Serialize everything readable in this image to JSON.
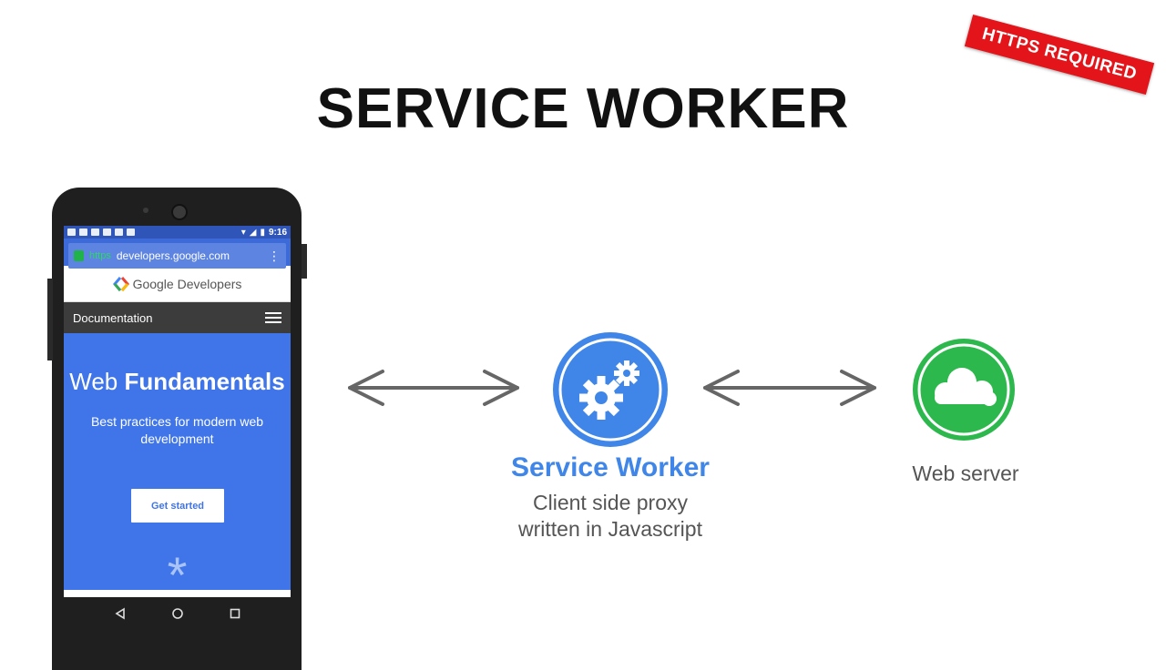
{
  "slide": {
    "title": "SERVICE WORKER",
    "stamp": "HTTPS REQUIRED"
  },
  "phone": {
    "status_time": "9:16",
    "url_scheme": "https",
    "url": "developers.google.com",
    "brand": "Google Developers",
    "nav_label": "Documentation",
    "hero_title_light": "Web ",
    "hero_title_bold": "Fundamentals",
    "hero_subtitle": "Best practices for modern web development",
    "cta_label": "Get started"
  },
  "diagram": {
    "service_worker": {
      "label": "Service Worker",
      "desc_line1": "Client side proxy",
      "desc_line2": "written in Javascript",
      "icon": "gears-icon"
    },
    "web_server": {
      "label": "Web server",
      "icon": "cloud-icon"
    }
  },
  "colors": {
    "stamp": "#e3151b",
    "service_worker_blue": "#3f86e8",
    "web_server_green": "#2db84d",
    "arrow_gray": "#666666",
    "hero_blue": "#3f75e8"
  }
}
